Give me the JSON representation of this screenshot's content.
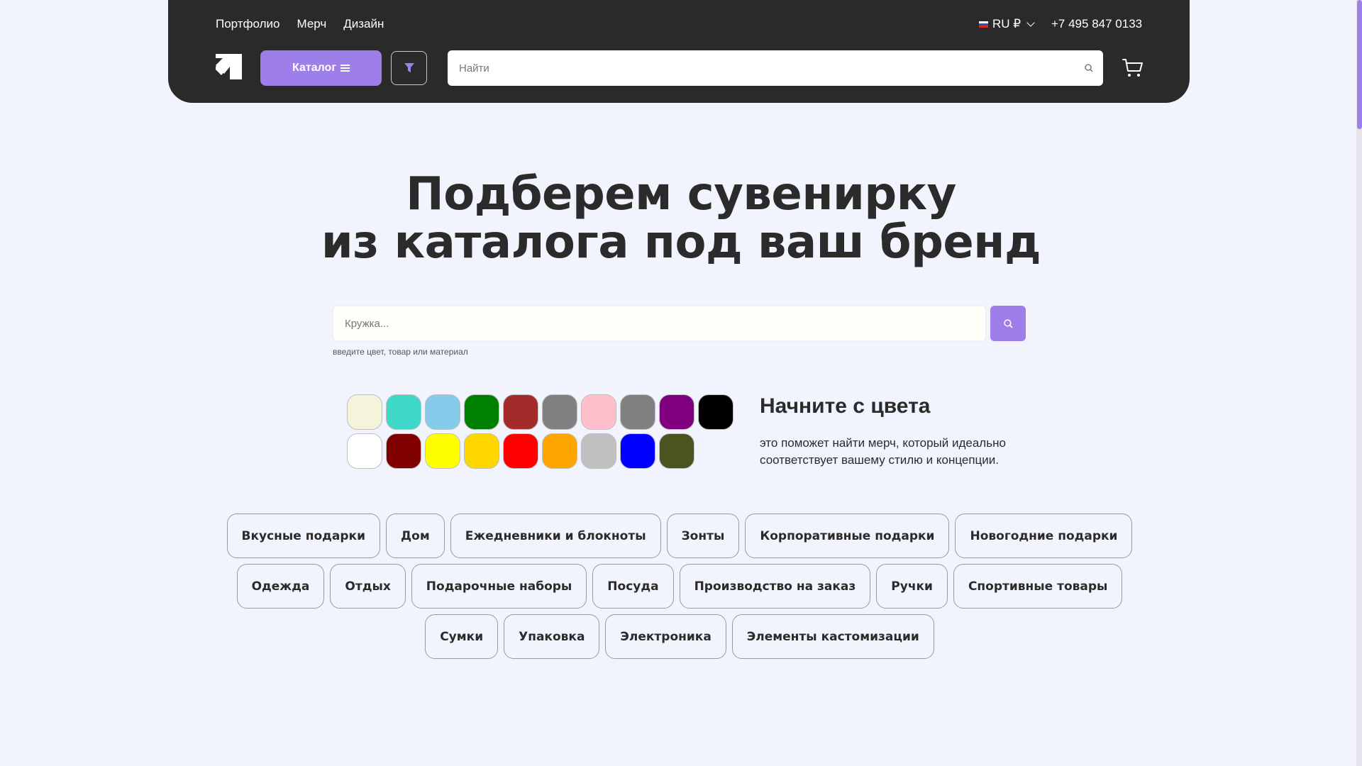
{
  "header": {
    "nav": [
      "Портфолио",
      "Мерч",
      "Дизайн"
    ],
    "locale": "RU ₽",
    "phone": "+7 495 847 0133",
    "catalog_label": "Каталог",
    "search_placeholder": "Найти"
  },
  "hero": {
    "title_line1": "Подберем сувенирку",
    "title_line2": "из каталога под ваш бренд",
    "search_placeholder": "Кружка...",
    "hint": "введите цвет, товар или материал"
  },
  "colors": {
    "title": "Начните с цвета",
    "text": "это поможет найти мерч, который идеально соответствует вашему стилю и концепции.",
    "swatches": [
      "#f4f4dc",
      "#3fd8c9",
      "#86cbea",
      "#008000",
      "#a52a2a",
      "#808080",
      "#ffc0cb",
      "#808080",
      "#800080",
      "#000000",
      "#ffffff",
      "#800000",
      "#ffff00",
      "#ffd700",
      "#ff0000",
      "#ffa500",
      "#c0c0c0",
      "#0000ff",
      "#4b5320"
    ]
  },
  "categories": [
    "Вкусные подарки",
    "Дом",
    "Ежедневники и блокноты",
    "Зонты",
    "Корпоративные подарки",
    "Новогодние подарки",
    "Одежда",
    "Отдых",
    "Подарочные наборы",
    "Посуда",
    "Производство на заказ",
    "Ручки",
    "Спортивные товары",
    "Сумки",
    "Упаковка",
    "Электроника",
    "Элементы кастомизации"
  ],
  "theme": {
    "accent": "#9e7ee8",
    "header_bg": "#2a2a2a",
    "page_bg": "#f1f4fd"
  }
}
